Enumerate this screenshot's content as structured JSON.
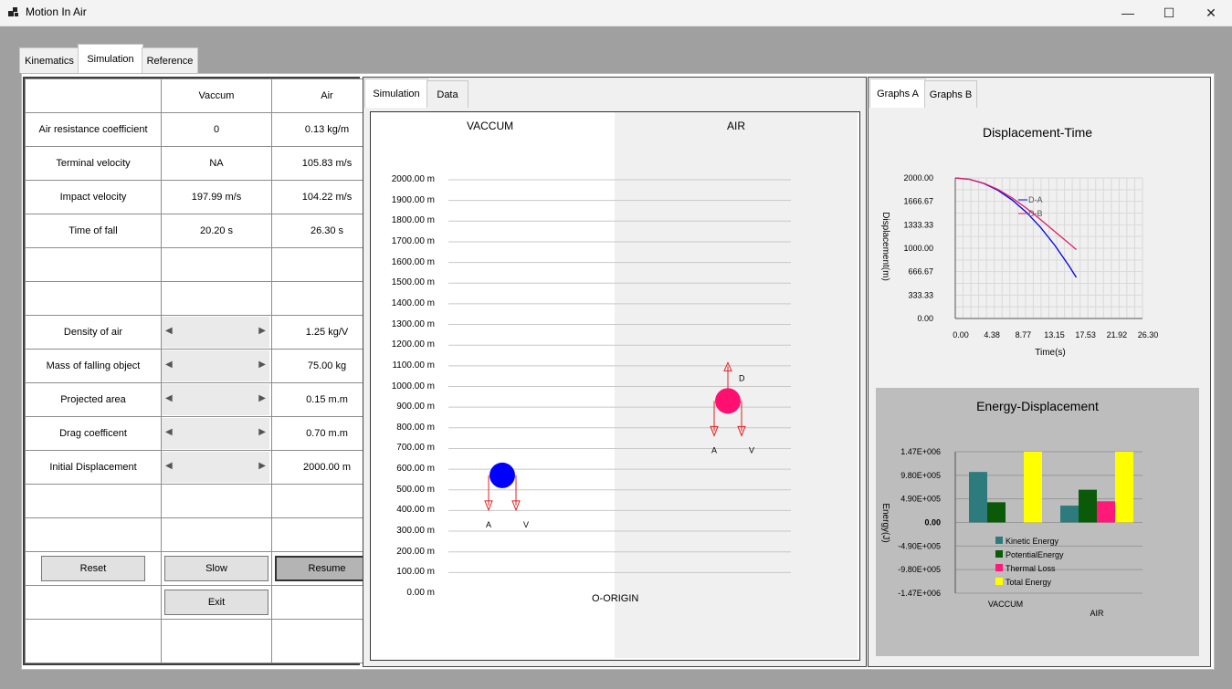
{
  "window": {
    "title": "Motion In Air",
    "minimize": "—",
    "maximize": "☐",
    "close": "✕"
  },
  "main_tabs": [
    "Kinematics",
    "Simulation",
    "Reference"
  ],
  "grid": {
    "headers": [
      "",
      "Vaccum",
      "Air"
    ],
    "rows": [
      {
        "label": "Air resistance coefficient",
        "vaccum": "0",
        "air": "0.13 kg/m"
      },
      {
        "label": "Terminal velocity",
        "vaccum": "NA",
        "air": "105.83 m/s"
      },
      {
        "label": "Impact velocity",
        "vaccum": "197.99 m/s",
        "air": "104.22 m/s"
      },
      {
        "label": "Time of fall",
        "vaccum": "20.20 s",
        "air": "26.30 s"
      }
    ],
    "inputs": [
      {
        "label": "Density of air",
        "value": "1.25 kg/V"
      },
      {
        "label": "Mass of falling object",
        "value": "75.00 kg"
      },
      {
        "label": "Projected area",
        "value": "0.15 m.m"
      },
      {
        "label": "Drag coefficent",
        "value": "0.70 m.m"
      },
      {
        "label": "Initial Displacement",
        "value": "2000.00 m"
      }
    ],
    "slider_left": "◀",
    "slider_right": "▶",
    "buttons": {
      "reset": "Reset",
      "slow": "Slow",
      "resume": "Resume",
      "exit": "Exit"
    }
  },
  "sim_tabs": [
    "Simulation",
    "Data"
  ],
  "simulation": {
    "vaccum_label": "VACCUM",
    "air_label": "AIR",
    "origin_label": "O-ORIGIN",
    "y_labels": [
      "2000.00 m",
      "1900.00 m",
      "1800.00 m",
      "1700.00 m",
      "1600.00 m",
      "1500.00 m",
      "1400.00 m",
      "1300.00 m",
      "1200.00 m",
      "1100.00 m",
      "1000.00 m",
      "900.00 m",
      "800.00 m",
      "700.00 m",
      "600.00 m",
      "500.00 m",
      "400.00 m",
      "300.00 m",
      "200.00 m",
      "100.00 m",
      "0.00 m"
    ],
    "vaccum_ball": {
      "height_m": 570,
      "color": "#0000ff",
      "labels": [
        "A",
        "V"
      ]
    },
    "air_ball": {
      "height_m": 930,
      "color": "#ff1070",
      "labels": [
        "A",
        "V",
        "D"
      ]
    }
  },
  "graph_tabs": [
    "Graphs A",
    "Graphs B"
  ],
  "chart_data": [
    {
      "type": "line",
      "title": "Displacement-Time",
      "xlabel": "Time(s)",
      "ylabel": "Displacement(m)",
      "x_ticks": [
        "0.00",
        "4.38",
        "8.77",
        "13.15",
        "17.53",
        "21.92",
        "26.30"
      ],
      "y_ticks": [
        "2000.00",
        "1666.67",
        "1333.33",
        "1000.00",
        "666.67",
        "333.33",
        "0.00"
      ],
      "xlim": [
        0,
        26.3
      ],
      "ylim": [
        0,
        2000
      ],
      "grid": true,
      "legend_position": "on-plot",
      "series": [
        {
          "name": "D-A",
          "color": "#0000dd",
          "x": [
            0,
            2,
            4,
            6,
            8,
            10,
            12,
            14,
            16,
            17
          ],
          "y": [
            2000,
            1980,
            1922,
            1824,
            1686,
            1510,
            1294,
            1039,
            745,
            584
          ]
        },
        {
          "name": "D-B",
          "color": "#e0206a",
          "x": [
            0,
            2,
            4,
            6,
            8,
            10,
            12,
            14,
            16,
            17
          ],
          "y": [
            2000,
            1981,
            1926,
            1836,
            1715,
            1569,
            1406,
            1236,
            1066,
            980
          ]
        }
      ]
    },
    {
      "type": "bar",
      "title": "Energy-Displacement",
      "ylabel": "Energy(J)",
      "categories": [
        "VACCUM",
        "AIR"
      ],
      "y_ticks": [
        "1.47E+006",
        "9.80E+005",
        "4.90E+005",
        "0.00",
        "-4.90E+005",
        "-9.80E+005",
        "-1.47E+006"
      ],
      "ylim": [
        -1470000,
        1470000
      ],
      "legend_position": "bottom-left",
      "series": [
        {
          "name": "Kinetic Energy",
          "color": "#2e7b7e",
          "values": [
            1050000,
            350000
          ]
        },
        {
          "name": "PotentialEnergy",
          "color": "#0a5a0a",
          "values": [
            420000,
            680000
          ]
        },
        {
          "name": "Thermal Loss",
          "color": "#ff1a7a",
          "values": [
            0,
            440000
          ]
        },
        {
          "name": "Total Energy",
          "color": "#ffff00",
          "values": [
            1470000,
            1470000
          ]
        }
      ]
    }
  ]
}
